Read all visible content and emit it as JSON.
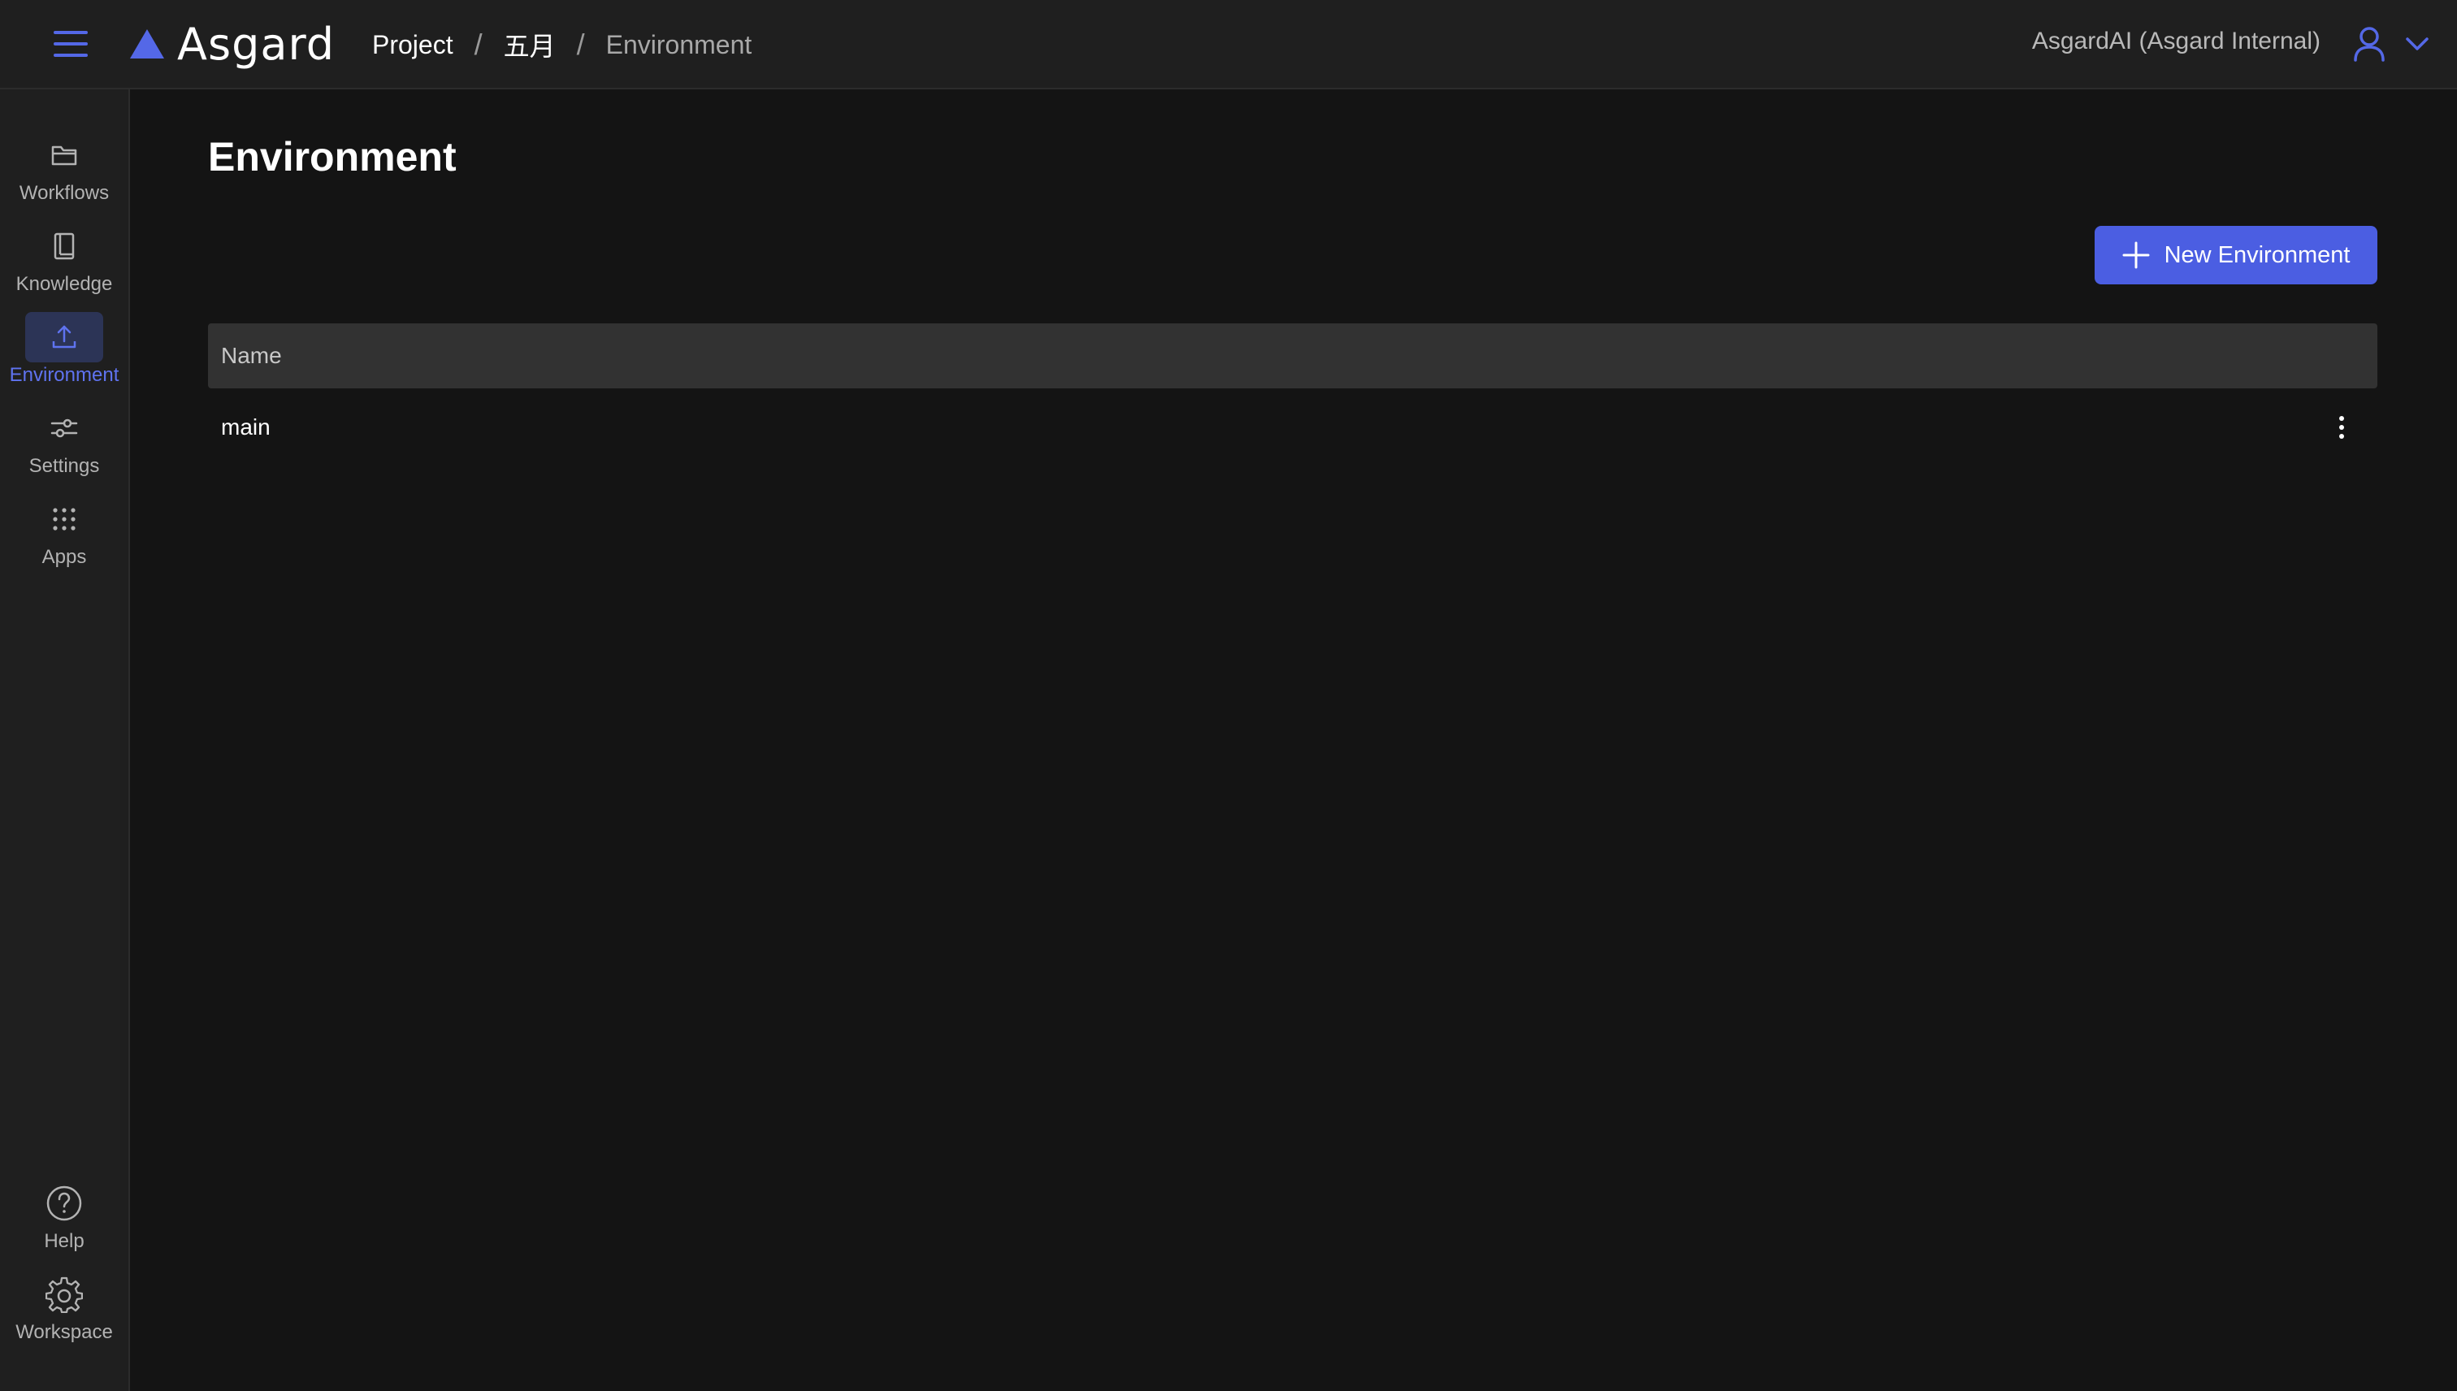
{
  "colors": {
    "accent": "#4b5ee2",
    "background": "#141414",
    "panel": "#1f1f1f",
    "table_header": "#323232"
  },
  "topbar": {
    "logo_text": "Asgard",
    "breadcrumb": [
      "Project",
      "五月",
      "Environment"
    ],
    "separator": "/",
    "organization": "AsgardAI (Asgard Internal)"
  },
  "sidebar": {
    "items": [
      {
        "label": "Workflows",
        "icon": "folder-icon"
      },
      {
        "label": "Knowledge",
        "icon": "book-icon"
      },
      {
        "label": "Environment",
        "icon": "upload-icon",
        "active": true
      },
      {
        "label": "Settings",
        "icon": "sliders-icon"
      },
      {
        "label": "Apps",
        "icon": "grid-icon"
      }
    ],
    "bottom_items": [
      {
        "label": "Help",
        "icon": "help-icon"
      },
      {
        "label": "Workspace",
        "icon": "gear-icon"
      }
    ]
  },
  "main": {
    "title": "Environment",
    "new_button_label": "New Environment",
    "table": {
      "columns": [
        "Name"
      ],
      "rows": [
        {
          "name": "main"
        }
      ]
    }
  }
}
